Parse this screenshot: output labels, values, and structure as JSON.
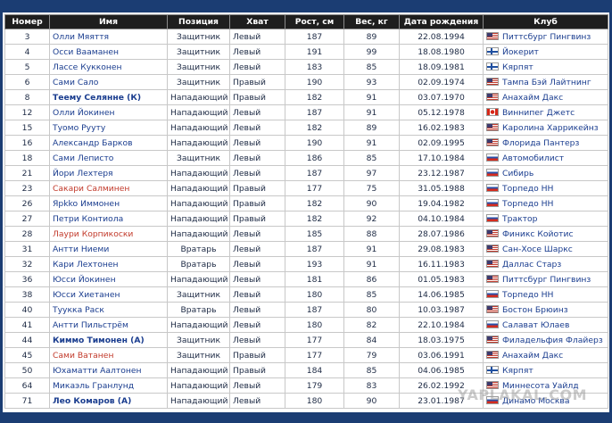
{
  "table": {
    "headers": [
      "Номер",
      "Имя",
      "Позиция",
      "Хват",
      "Рост, см",
      "Вес, кг",
      "Дата рождения",
      "Клуб"
    ],
    "rows": [
      {
        "number": "3",
        "name": "Олли Мяяття",
        "position": "Защитник",
        "hand": "Левый",
        "height": "187",
        "weight": "89",
        "birth": "22.08.1994",
        "club": "Питтсбург Пингвинз",
        "flag": "usa",
        "style": ""
      },
      {
        "number": "4",
        "name": "Осси Вааманен",
        "position": "Защитник",
        "hand": "Левый",
        "height": "191",
        "weight": "99",
        "birth": "18.08.1980",
        "club": "Йокерит",
        "flag": "fin",
        "style": ""
      },
      {
        "number": "5",
        "name": "Лассе Кукконен",
        "position": "Защитник",
        "hand": "Левый",
        "height": "183",
        "weight": "85",
        "birth": "18.09.1981",
        "club": "Кярпят",
        "flag": "fin",
        "style": ""
      },
      {
        "number": "6",
        "name": "Сами Сало",
        "position": "Защитник",
        "hand": "Правый",
        "height": "190",
        "weight": "93",
        "birth": "02.09.1974",
        "club": "Тампа Бэй Лайтнинг",
        "flag": "usa",
        "style": ""
      },
      {
        "number": "8",
        "name": "Теему Селянне (К)",
        "position": "Нападающий",
        "hand": "Правый",
        "height": "182",
        "weight": "91",
        "birth": "03.07.1970",
        "club": "Анахайм Дакс",
        "flag": "usa",
        "style": "bold"
      },
      {
        "number": "12",
        "name": "Олли Йокинен",
        "position": "Нападающий",
        "hand": "Левый",
        "height": "187",
        "weight": "91",
        "birth": "05.12.1978",
        "club": "Виннипег Джетс",
        "flag": "can",
        "style": ""
      },
      {
        "number": "15",
        "name": "Туомо Рууту",
        "position": "Нападающий",
        "hand": "Левый",
        "height": "182",
        "weight": "89",
        "birth": "16.02.1983",
        "club": "Каролина Харрикейнз",
        "flag": "usa",
        "style": ""
      },
      {
        "number": "16",
        "name": "Александр Барков",
        "position": "Нападающий",
        "hand": "Левый",
        "height": "190",
        "weight": "91",
        "birth": "02.09.1995",
        "club": "Флорида Пантерз",
        "flag": "usa",
        "style": ""
      },
      {
        "number": "18",
        "name": "Сами Леписто",
        "position": "Защитник",
        "hand": "Левый",
        "height": "186",
        "weight": "85",
        "birth": "17.10.1984",
        "club": "Автомобилист",
        "flag": "rus",
        "style": ""
      },
      {
        "number": "21",
        "name": "Йори Лехтеря",
        "position": "Нападающий",
        "hand": "Левый",
        "height": "187",
        "weight": "97",
        "birth": "23.12.1987",
        "club": "Сибирь",
        "flag": "rus",
        "style": ""
      },
      {
        "number": "23",
        "name": "Сакари Салминен",
        "position": "Нападающий",
        "hand": "Правый",
        "height": "177",
        "weight": "75",
        "birth": "31.05.1988",
        "club": "Торпедо НН",
        "flag": "rus",
        "style": "red"
      },
      {
        "number": "26",
        "name": "Ярkko Иммонен",
        "position": "Нападающий",
        "hand": "Правый",
        "height": "182",
        "weight": "90",
        "birth": "19.04.1982",
        "club": "Торпедо НН",
        "flag": "rus",
        "style": ""
      },
      {
        "number": "27",
        "name": "Петри Контиола",
        "position": "Нападающий",
        "hand": "Правый",
        "height": "182",
        "weight": "92",
        "birth": "04.10.1984",
        "club": "Трактор",
        "flag": "rus",
        "style": ""
      },
      {
        "number": "28",
        "name": "Лаури Корпикоски",
        "position": "Нападающий",
        "hand": "Левый",
        "height": "185",
        "weight": "88",
        "birth": "28.07.1986",
        "club": "Финикс Койотис",
        "flag": "usa",
        "style": "red"
      },
      {
        "number": "31",
        "name": "Антти Ниеми",
        "position": "Вратарь",
        "hand": "Левый",
        "height": "187",
        "weight": "91",
        "birth": "29.08.1983",
        "club": "Сан-Хосе Шаркс",
        "flag": "usa",
        "style": ""
      },
      {
        "number": "32",
        "name": "Кари Лехтонен",
        "position": "Вратарь",
        "hand": "Левый",
        "height": "193",
        "weight": "91",
        "birth": "16.11.1983",
        "club": "Даллас Старз",
        "flag": "usa",
        "style": ""
      },
      {
        "number": "36",
        "name": "Юсси Йокинен",
        "position": "Нападающий",
        "hand": "Левый",
        "height": "181",
        "weight": "86",
        "birth": "01.05.1983",
        "club": "Питтсбург Пингвинз",
        "flag": "usa",
        "style": ""
      },
      {
        "number": "38",
        "name": "Юсси Хиетанен",
        "position": "Защитник",
        "hand": "Левый",
        "height": "180",
        "weight": "85",
        "birth": "14.06.1985",
        "club": "Торпедо НН",
        "flag": "rus",
        "style": ""
      },
      {
        "number": "40",
        "name": "Туукка Раск",
        "position": "Вратарь",
        "hand": "Левый",
        "height": "187",
        "weight": "80",
        "birth": "10.03.1987",
        "club": "Бостон Брюинз",
        "flag": "usa",
        "style": ""
      },
      {
        "number": "41",
        "name": "Антти Пильстрём",
        "position": "Нападающий",
        "hand": "Левый",
        "height": "180",
        "weight": "82",
        "birth": "22.10.1984",
        "club": "Салават Юлаев",
        "flag": "rus",
        "style": ""
      },
      {
        "number": "44",
        "name": "Киммо Тимонен (А)",
        "position": "Защитник",
        "hand": "Левый",
        "height": "177",
        "weight": "84",
        "birth": "18.03.1975",
        "club": "Филадельфия Флайерз",
        "flag": "usa",
        "style": "bold"
      },
      {
        "number": "45",
        "name": "Сами Ватанен",
        "position": "Защитник",
        "hand": "Правый",
        "height": "177",
        "weight": "79",
        "birth": "03.06.1991",
        "club": "Анахайм Дакс",
        "flag": "usa",
        "style": "red"
      },
      {
        "number": "50",
        "name": "Юхаматти Аалтонен",
        "position": "Нападающий",
        "hand": "Правый",
        "height": "184",
        "weight": "85",
        "birth": "04.06.1985",
        "club": "Кярпят",
        "flag": "fin",
        "style": ""
      },
      {
        "number": "64",
        "name": "Микаэль Гранлунд",
        "position": "Нападающий",
        "hand": "Левый",
        "height": "179",
        "weight": "83",
        "birth": "26.02.1992",
        "club": "Миннесота Уайлд",
        "flag": "usa",
        "style": ""
      },
      {
        "number": "71",
        "name": "Лео Комаров (А)",
        "position": "Нападающий",
        "hand": "Левый",
        "height": "180",
        "weight": "90",
        "birth": "23.01.1987",
        "club": "Динамо Москва",
        "flag": "rus",
        "style": "bold"
      }
    ]
  },
  "watermark": "YAPLAKAL.COM"
}
